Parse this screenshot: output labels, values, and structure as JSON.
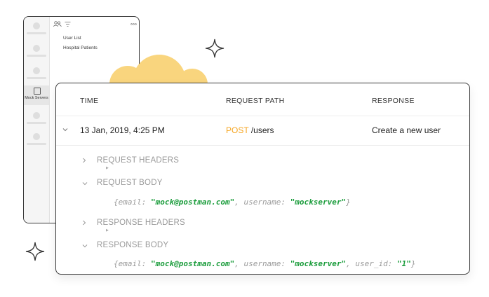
{
  "background_window": {
    "sidebar_active_label": "Mock Servers",
    "list_items": [
      "User List",
      "Hospital Patients"
    ],
    "toolbar_icons": [
      "people-icon",
      "filter-icon",
      "more-icon"
    ]
  },
  "table": {
    "headers": {
      "time": "TIME",
      "path": "REQUEST PATH",
      "response": "RESPONSE"
    },
    "row": {
      "time": "13 Jan, 2019, 4:25 PM",
      "method": "POST",
      "path": "/users",
      "response": "Create a new user"
    }
  },
  "details": {
    "request_headers": "REQUEST HEADERS",
    "request_body": "REQUEST BODY",
    "request_body_code": {
      "open": "{email: ",
      "email_value": "\"mock@postman.com\"",
      "mid": ", username: ",
      "username_value": "\"mockserver\"",
      "close": "}"
    },
    "response_headers": "RESPONSE HEADERS",
    "response_body": "RESPONSE BODY",
    "response_body_code": {
      "open": "{email: ",
      "email_value": "\"mock@postman.com\"",
      "mid": ", username: ",
      "username_value": "\"mockserver\"",
      "mid2": ", user_id: ",
      "user_id_value": "\"1\"",
      "close": "}"
    }
  },
  "colors": {
    "method_post": "#f5a623",
    "string_value": "#1a9c3b",
    "cloud": "#f9d57e"
  }
}
